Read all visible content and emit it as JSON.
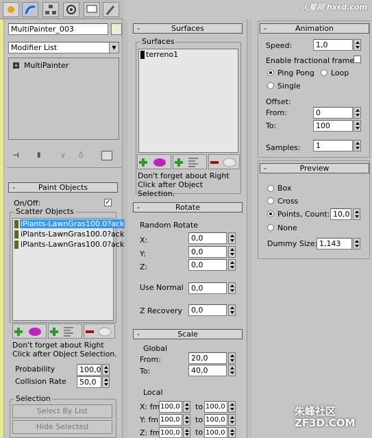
{
  "top_tabs": [
    "create-icon",
    "modify-icon",
    "hierarchy-icon",
    "motion-icon",
    "display-icon",
    "utilities-icon"
  ],
  "object_name": "MultiPainter_003",
  "modifier_list": "Modifier List",
  "stack_item": "MultiPainter",
  "paint_objects": {
    "title": "Paint Objects",
    "onoff": "On/Off:",
    "scatter": "Scatter Objects",
    "items": [
      "iPlants-LawnGras100.0?ack",
      "iPlants-LawnGras100.0?ack",
      "iPlants-LawnGras100.0?ack"
    ],
    "note": "Don't forget about Right Click after Object Selection.",
    "probability_label": "Probability",
    "probability": "100,0",
    "collision_label": "Collision Rate",
    "collision": "50,0",
    "selection": "Selection",
    "select_by_list": "Select By List",
    "hide_selected": "Hide Selected"
  },
  "surfaces": {
    "title": "Surfaces",
    "group": "Surfaces",
    "items": [
      "terreno1"
    ],
    "note": "Don't forget about Right Click after Object Selection."
  },
  "rotate": {
    "title": "Rotate",
    "random": "Random Rotate",
    "x": "X:",
    "y": "Y:",
    "z": "Z:",
    "xv": "0,0",
    "yv": "0,0",
    "zv": "0,0",
    "use_normal": "Use Normal",
    "use_normal_v": "0,0",
    "zrec": "Z Recovery",
    "zrec_v": "0,0"
  },
  "scale": {
    "title": "Scale",
    "global": "Global",
    "from": "From:",
    "from_v": "20,0",
    "to": "To:",
    "to_v": "40,0",
    "local": "Local",
    "xfm": "X: fm",
    "yfm": "Y: fm",
    "zfm": "Z: fm",
    "to_lbl": "to",
    "v1": "100,0",
    "v2": "100,0"
  },
  "animation": {
    "title": "Animation",
    "speed": "Speed:",
    "speed_v": "1,0",
    "frac": "Enable fractional frames",
    "ping": "Ping Pong",
    "loop": "Loop",
    "single": "Single",
    "offset": "Offset:",
    "from": "From:",
    "from_v": "0",
    "to": "To:",
    "to_v": "100",
    "samples": "Samples:",
    "samples_v": "1"
  },
  "preview": {
    "title": "Preview",
    "box": "Box",
    "cross": "Cross",
    "points": "Points,",
    "count": "Count:",
    "count_v": "10,0",
    "none": "None",
    "dummy": "Dummy Size:",
    "dummy_v": "1,143"
  },
  "watermark_top": "火星网 hxsd.com",
  "watermark_bottom": "朱峰社区 ZF3D.COM"
}
